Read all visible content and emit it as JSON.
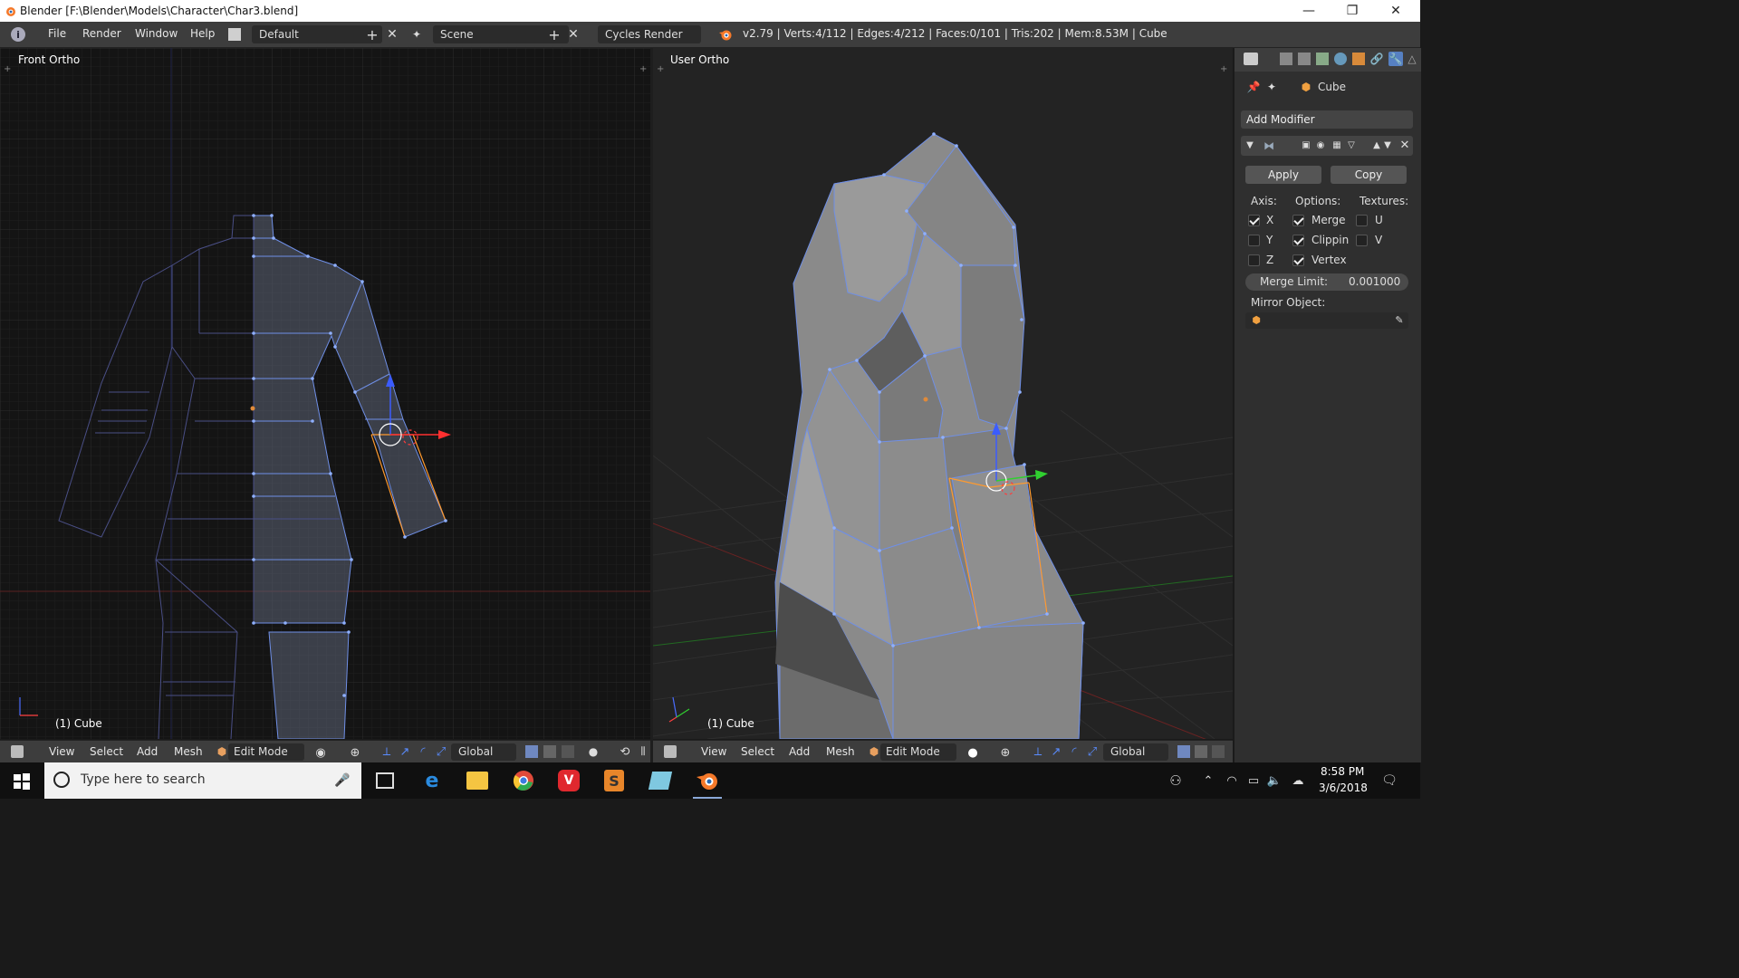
{
  "window": {
    "title": "Blender [F:\\Blender\\Models\\Character\\Char3.blend]",
    "minimize": "—",
    "restore": "❐",
    "close": "✕"
  },
  "topbar": {
    "menus": [
      "File",
      "Render",
      "Window",
      "Help"
    ],
    "layout_name": "Default",
    "scene_name": "Scene",
    "render_engine": "Cycles Render",
    "stats": "v2.79 | Verts:4/112 | Edges:4/212 | Faces:0/101 | Tris:202 | Mem:8.53M | Cube"
  },
  "viewport_left": {
    "label": "Front Ortho",
    "object_label": "(1) Cube",
    "menus": [
      "View",
      "Select",
      "Add",
      "Mesh"
    ],
    "mode": "Edit Mode",
    "orientation": "Global"
  },
  "viewport_right": {
    "label": "User Ortho",
    "object_label": "(1) Cube",
    "menus": [
      "View",
      "Select",
      "Add",
      "Mesh"
    ],
    "mode": "Edit Mode",
    "orientation": "Global"
  },
  "properties": {
    "object_name": "Cube",
    "add_modifier": "Add Modifier",
    "apply": "Apply",
    "copy": "Copy",
    "axis_label": "Axis:",
    "options_label": "Options:",
    "textures_label": "Textures:",
    "axis": [
      {
        "label": "X",
        "checked": true
      },
      {
        "label": "Y",
        "checked": false
      },
      {
        "label": "Z",
        "checked": false
      }
    ],
    "options": [
      {
        "label": "Merge",
        "checked": true
      },
      {
        "label": "Clippin",
        "checked": true
      },
      {
        "label": "Vertex",
        "checked": true
      }
    ],
    "textures": [
      {
        "label": "U",
        "checked": false
      },
      {
        "label": "V",
        "checked": false
      }
    ],
    "merge_limit_label": "Merge Limit:",
    "merge_limit_value": "0.001000",
    "mirror_object_label": "Mirror Object:"
  },
  "taskbar": {
    "search_placeholder": "Type here to search",
    "time": "8:58 PM",
    "date": "3/6/2018",
    "apps": [
      "task-view-icon",
      "edge-icon",
      "file-explorer-icon",
      "chrome-icon",
      "vivaldi-icon",
      "sublime-icon",
      "app-icon",
      "blender-icon"
    ]
  },
  "colors": {
    "accent_blue": "#5680c2",
    "wire_blue": "#6f8fe6",
    "selected_orange": "#ff9a2e",
    "blender_orange": "#f5792a"
  }
}
